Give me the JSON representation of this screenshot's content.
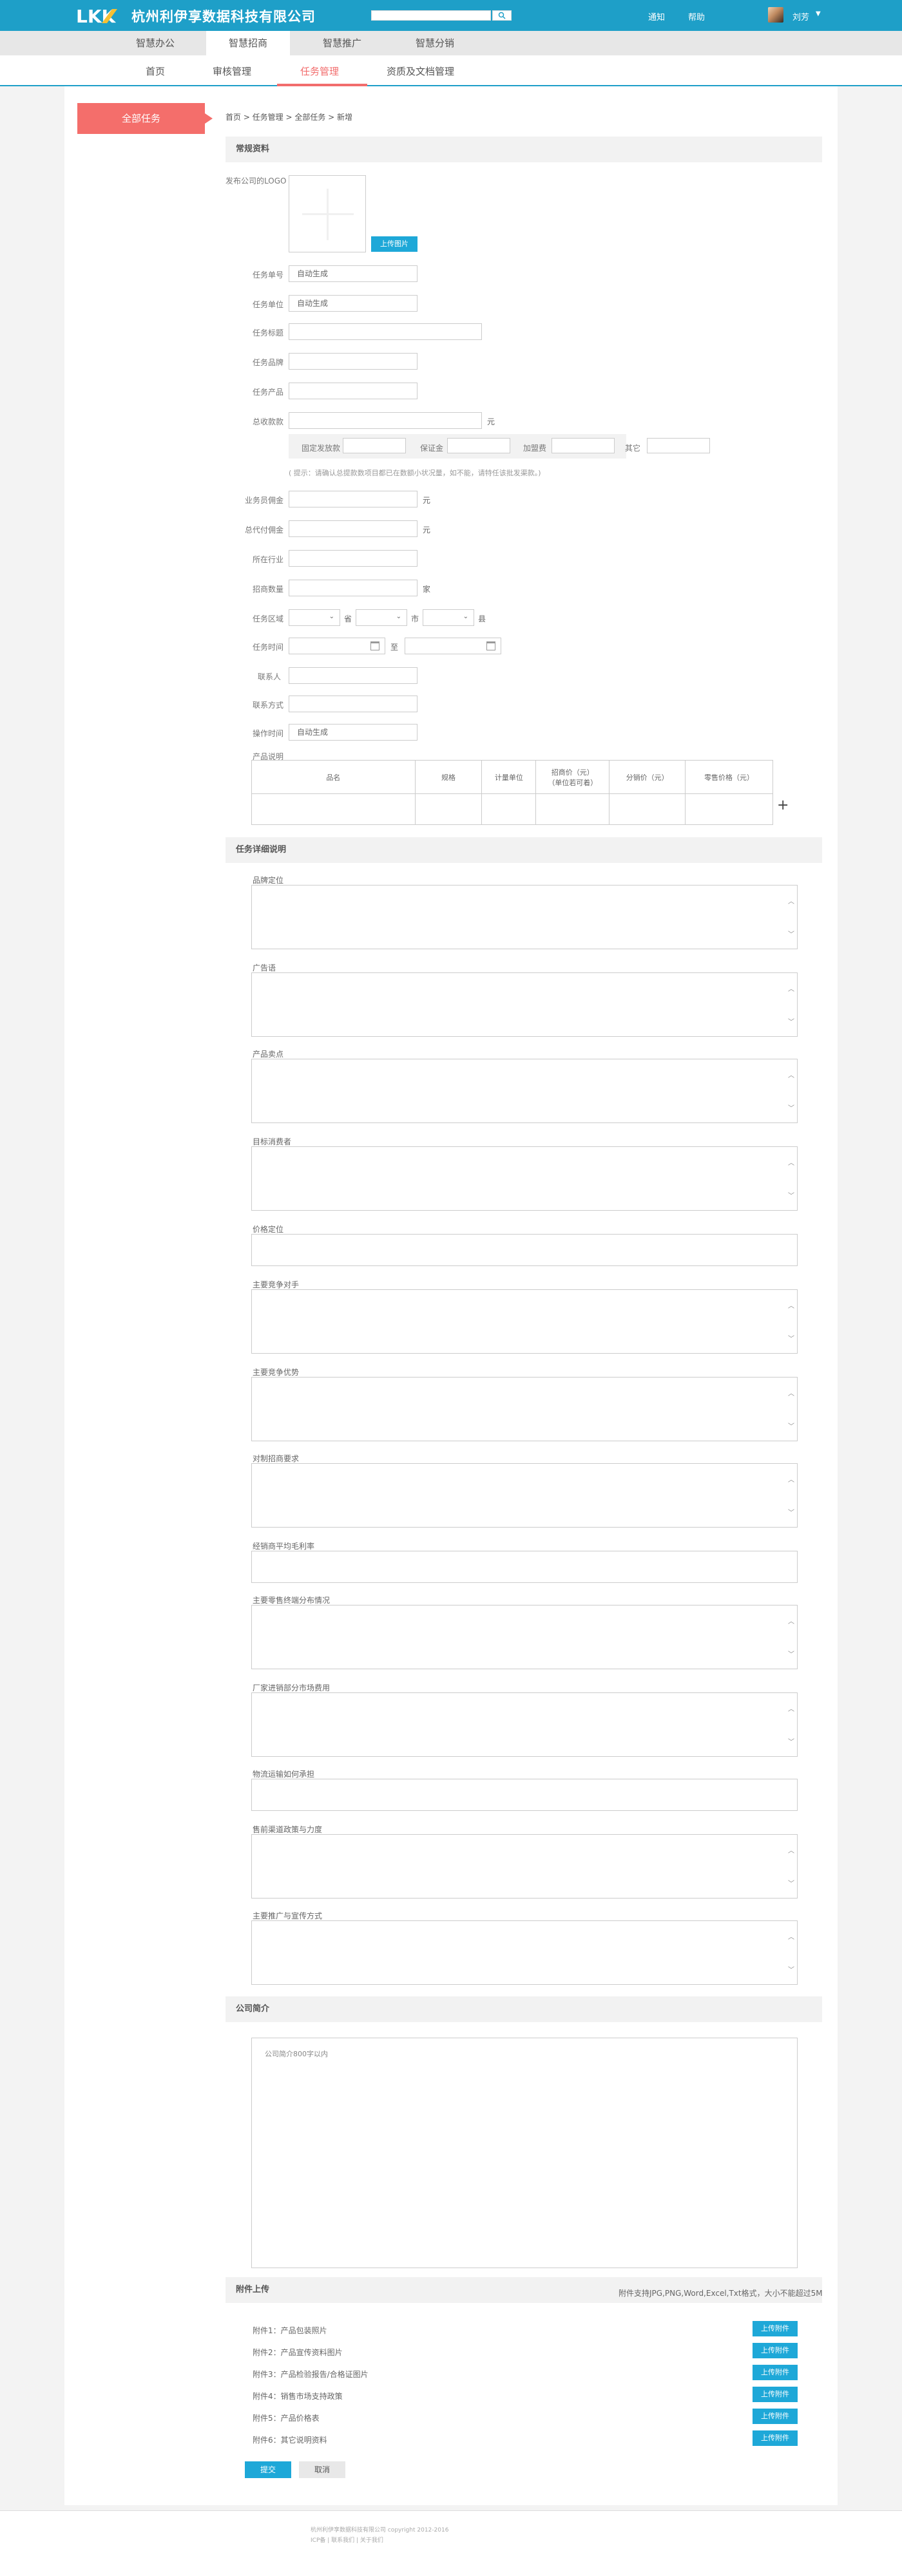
{
  "header": {
    "logo_text": "LKK",
    "company": "杭州利伊享数据科技有限公司",
    "search_placeholder": "",
    "links": {
      "notify": "通知",
      "help": "帮助"
    },
    "user": "刘芳",
    "colors": {
      "primary": "#1e9fc8",
      "accent": "#f46e6b"
    }
  },
  "mainnav": [
    {
      "label": "智慧办公"
    },
    {
      "label": "智慧招商"
    },
    {
      "label": "智慧推广"
    },
    {
      "label": "智慧分销"
    }
  ],
  "subnav": [
    {
      "label": "首页"
    },
    {
      "label": "审核管理"
    },
    {
      "label": "任务管理"
    },
    {
      "label": "资质及文档管理"
    }
  ],
  "sidebar": {
    "all_tasks": "全部任务"
  },
  "breadcrumb": "首页 > 任务管理 > 全部任务 > 新增",
  "sections": {
    "basic": "常规资料",
    "detail": "任务详细说明",
    "intro": "公司简介",
    "attach": "附件上传"
  },
  "basic": {
    "logo_label": "发布公司的LOGO",
    "upload_image": "上传图片",
    "task_no": {
      "label": "任务单号",
      "value": "自动生成"
    },
    "task_unit": {
      "label": "任务单位",
      "value": "自动生成"
    },
    "task_title": {
      "label": "任务标题",
      "value": ""
    },
    "task_brand": {
      "label": "任务品牌",
      "value": ""
    },
    "task_product": {
      "label": "任务产品",
      "value": ""
    },
    "reward": {
      "label": "总收款款",
      "unit": "元"
    },
    "fees": {
      "fee1": "固定发放款",
      "fee2": "保证金",
      "fee3": "加盟费",
      "fee4": "其它"
    },
    "hint": "( 提示：请确认总提款数项目都已在数额小状况量，如不能，请特任该批发渠款。)",
    "sales_reward": {
      "label": "业务员佣金",
      "unit": "元"
    },
    "agent_reward": {
      "label": "总代付佣金",
      "unit": "元"
    },
    "industry": {
      "label": "所在行业"
    },
    "recruit_count": {
      "label": "招商数量",
      "unit": "家"
    },
    "region": {
      "label": "任务区域",
      "province": "省",
      "city": "市",
      "district": "县"
    },
    "period": {
      "label": "任务时间",
      "to": "至"
    },
    "contact": {
      "label": "联系人"
    },
    "contact_way": {
      "label": "联系方式"
    },
    "release_time": {
      "label": "操作时间",
      "value": "自动生成"
    }
  },
  "product_table": {
    "label": "产品说明",
    "headers": [
      "品名",
      "规格",
      "计量单位",
      "招商价（元）\n（单位若可着）",
      "分销价（元）",
      "零售价格（元）"
    ]
  },
  "detail_fields": [
    {
      "label": "品牌定位"
    },
    {
      "label": "广告语"
    },
    {
      "label": "产品卖点"
    },
    {
      "label": "目标消费者"
    },
    {
      "label": "价格定位"
    },
    {
      "label": "主要竞争对手"
    },
    {
      "label": "主要竞争优势"
    },
    {
      "label": "对制招商要求"
    },
    {
      "label": "经销商平均毛利率"
    },
    {
      "label": "主要零售终端分布情况"
    },
    {
      "label": "厂家进销部分市场费用"
    },
    {
      "label": "物流运输如何承担"
    },
    {
      "label": "售前渠道政策与力度"
    },
    {
      "label": "主要推广与宣传方式"
    }
  ],
  "intro": {
    "placeholder": "公司简介800字以内"
  },
  "attachments": {
    "note": "附件支持JPG,PNG,Word,Excel,Txt格式，大小不能超过5M",
    "items": [
      {
        "label": "附件1：产品包装照片",
        "button": "上传附件"
      },
      {
        "label": "附件2：产品宣传资料图片",
        "button": "上传附件"
      },
      {
        "label": "附件3：产品检验报告/合格证图片",
        "button": "上传附件"
      },
      {
        "label": "附件4：销售市场支持政策",
        "button": "上传附件"
      },
      {
        "label": "附件5：产品价格表",
        "button": "上传附件"
      },
      {
        "label": "附件6：其它说明资料",
        "button": "上传附件"
      }
    ]
  },
  "actions": {
    "submit": "提交",
    "cancel": "取消"
  },
  "footer": {
    "line1": "杭州利伊享数据科技有限公司   copyright  2012-2016",
    "line2": "ICP备    |  联系我们  |   关于我们"
  }
}
